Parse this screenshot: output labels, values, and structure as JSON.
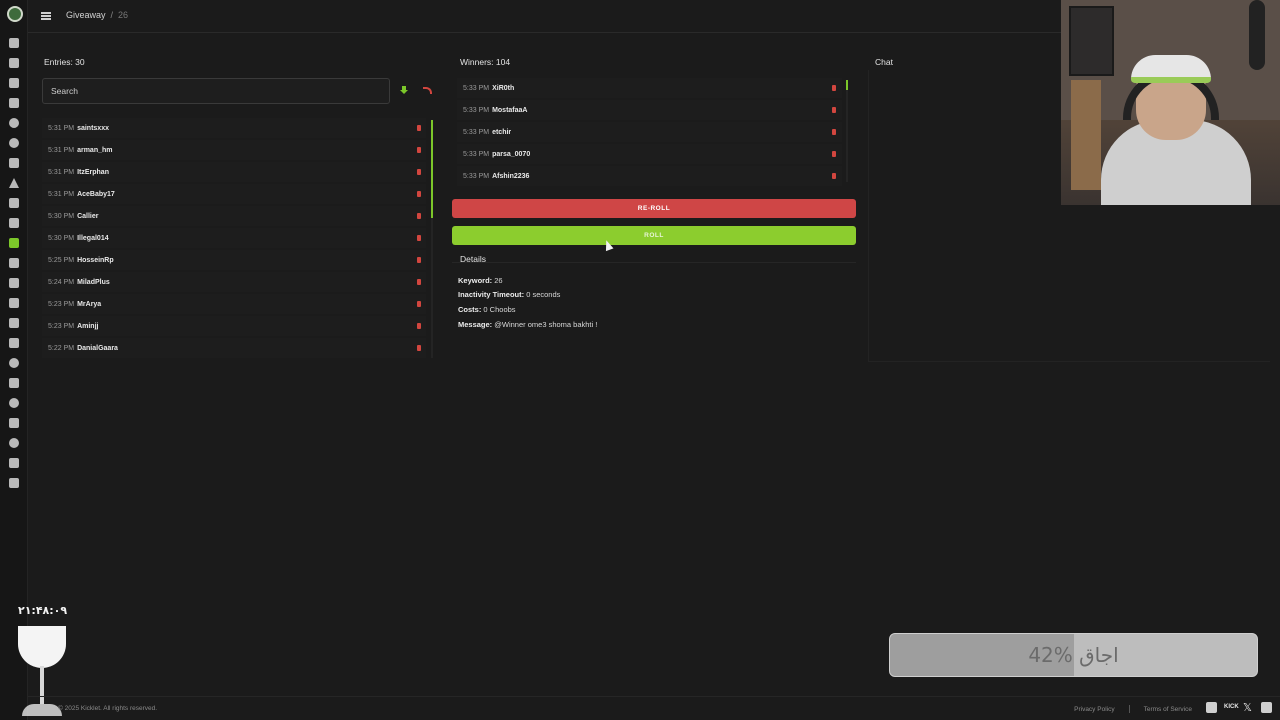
{
  "breadcrumb": {
    "section": "Giveaway",
    "current": "26"
  },
  "sidebar": {
    "icons": [
      "dashboard-icon",
      "document-icon",
      "pencil-icon",
      "wrench-icon",
      "chat-icon",
      "clock-icon",
      "shield-icon",
      "warning-icon",
      "music-icon",
      "star-icon",
      "gift-icon",
      "cart-icon",
      "link-icon",
      "chart-icon",
      "video-icon",
      "clipboard-icon",
      "emoji-icon",
      "film-icon",
      "comment-icon",
      "monitor-icon",
      "search-icon",
      "discord-icon",
      "list-icon"
    ],
    "active": "gift-icon"
  },
  "entries": {
    "title": "Entries: 30",
    "search_placeholder": "Search",
    "rows": [
      {
        "time": "5:31 PM",
        "name": "saintsxxx"
      },
      {
        "time": "5:31 PM",
        "name": "arman_hm"
      },
      {
        "time": "5:31 PM",
        "name": "ItzErphan"
      },
      {
        "time": "5:31 PM",
        "name": "AceBaby17"
      },
      {
        "time": "5:30 PM",
        "name": "Callier"
      },
      {
        "time": "5:30 PM",
        "name": "Illegal014"
      },
      {
        "time": "5:25 PM",
        "name": "HosseinRp"
      },
      {
        "time": "5:24 PM",
        "name": "MiladPlus"
      },
      {
        "time": "5:23 PM",
        "name": "MrArya"
      },
      {
        "time": "5:23 PM",
        "name": "Aminjj"
      },
      {
        "time": "5:22 PM",
        "name": "DanialGaara"
      }
    ]
  },
  "winners": {
    "title": "Winners: 104",
    "rows": [
      {
        "time": "5:33 PM",
        "name": "XiR0th"
      },
      {
        "time": "5:33 PM",
        "name": "MostafaaA"
      },
      {
        "time": "5:33 PM",
        "name": "etchir"
      },
      {
        "time": "5:33 PM",
        "name": "parsa_0070"
      },
      {
        "time": "5:33 PM",
        "name": "Afshin2236"
      }
    ],
    "reroll_label": "RE-ROLL",
    "roll_label": "ROLL"
  },
  "details": {
    "title": "Details",
    "keyword_label": "Keyword:",
    "keyword_value": " 26",
    "timeout_label": "Inactivity Timeout:",
    "timeout_value": " 0 seconds",
    "costs_label": "Costs:",
    "costs_value": " 0 Choobs",
    "message_label": "Message:",
    "message_value": " @Winner ome3 shoma bakhti !"
  },
  "chat": {
    "title": "Chat"
  },
  "overlay": {
    "timer": "۲۱:۴۸:۰۹",
    "progress_label": "42% اجاق",
    "progress_value": 0.5
  },
  "footer": {
    "copyright": "© 2025 Kicklet. All rights reserved.",
    "privacy": "Privacy Policy",
    "terms": "Terms of Service",
    "kick": "KICK",
    "x": "𝕏"
  },
  "colors": {
    "accent": "#7cc72a",
    "danger": "#cf4646",
    "background": "#1b1b1b"
  }
}
